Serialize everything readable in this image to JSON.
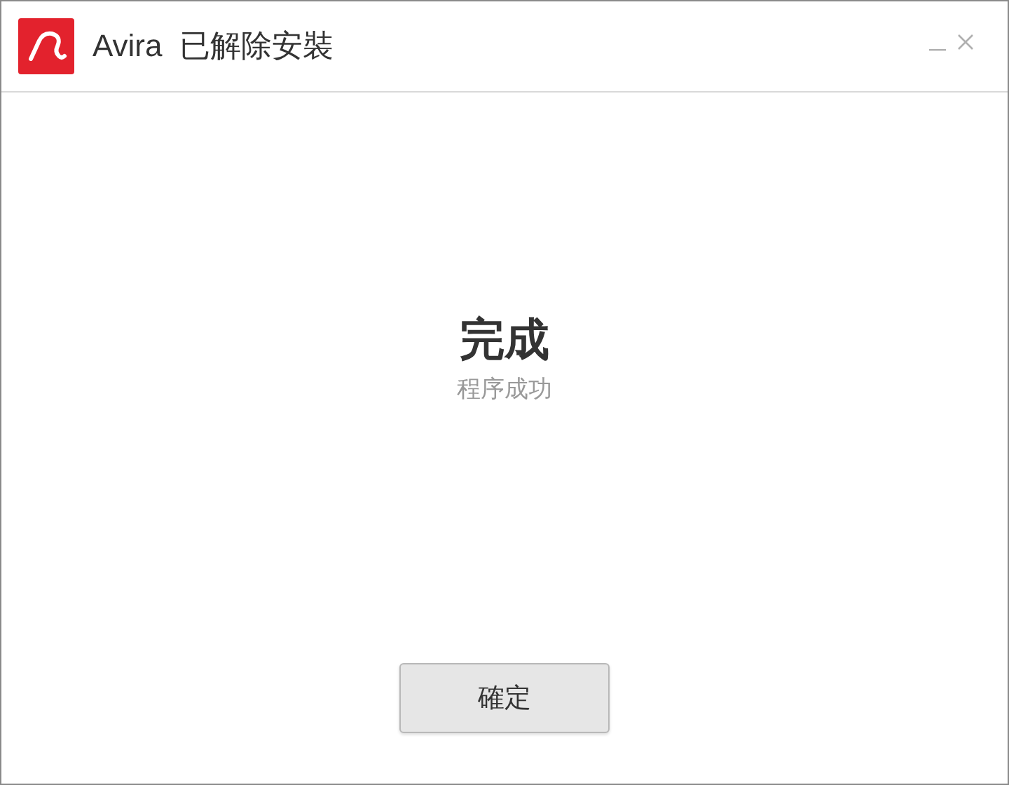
{
  "window": {
    "title": "Avira  已解除安裝"
  },
  "heading": "完成",
  "message": "程序成功",
  "buttons": [
    "確定"
  ]
}
